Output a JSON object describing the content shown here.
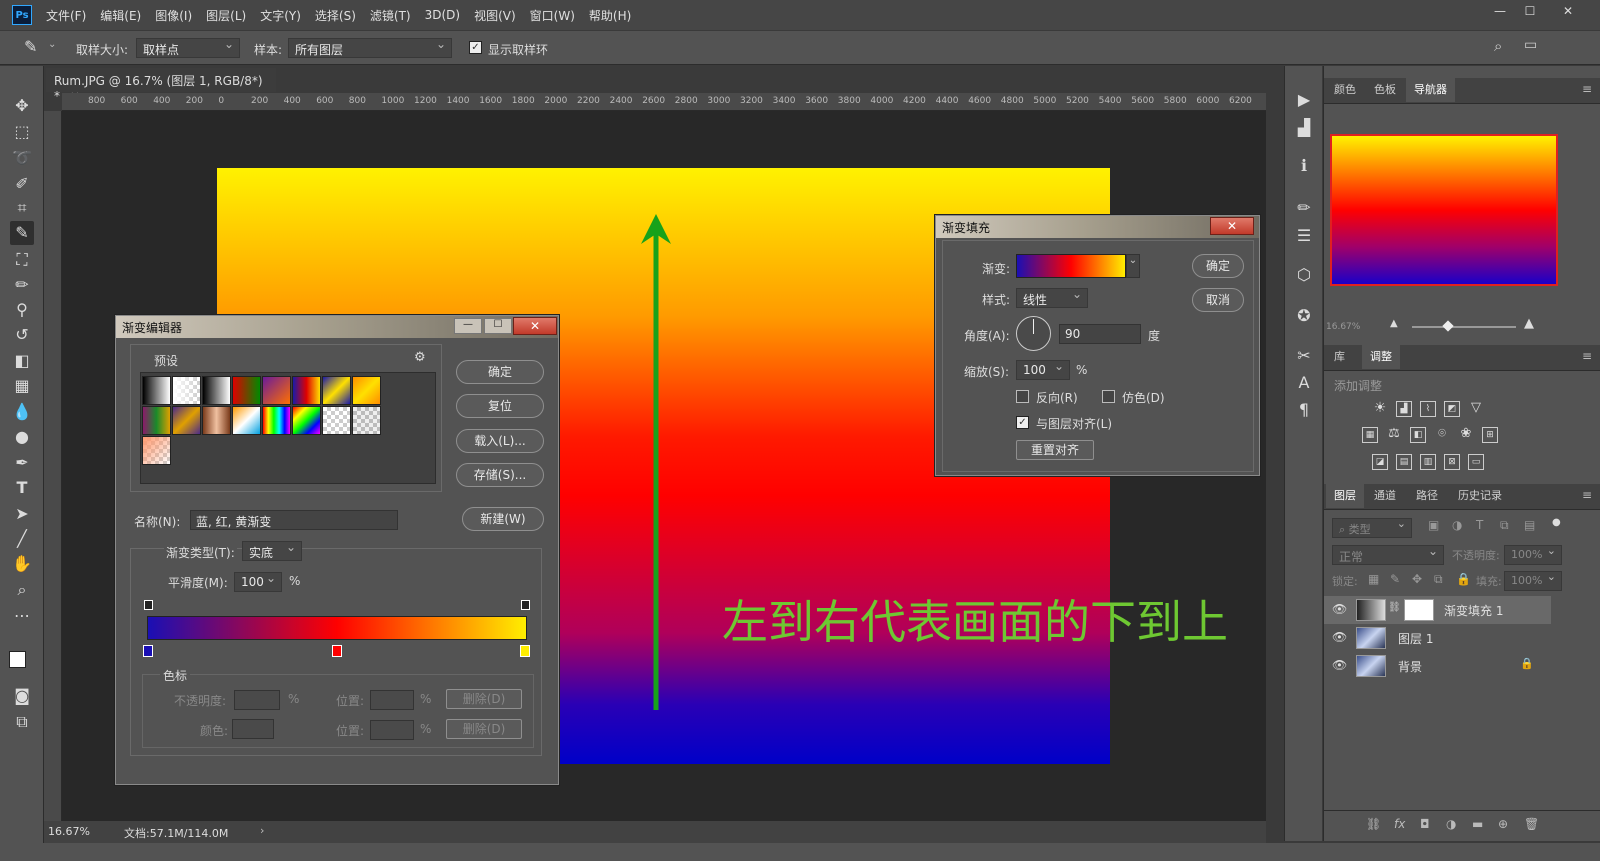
{
  "menu": {
    "logo": "Ps",
    "items": [
      "文件(F)",
      "编辑(E)",
      "图像(I)",
      "图层(L)",
      "文字(Y)",
      "选择(S)",
      "滤镜(T)",
      "3D(D)",
      "视图(V)",
      "窗口(W)",
      "帮助(H)"
    ]
  },
  "options": {
    "sample_size_label": "取样大小:",
    "sample_size_value": "取样点",
    "sample_label": "样本:",
    "sample_value": "所有图层",
    "show_ring_label": "显示取样环"
  },
  "document": {
    "tab_title": "Rum.JPG @ 16.7% (图层 1, RGB/8*) *",
    "ruler_marks": [
      "800",
      "600",
      "400",
      "200",
      "0",
      "200",
      "400",
      "600",
      "800",
      "1000",
      "1200",
      "1400",
      "1600",
      "1800",
      "2000",
      "2200",
      "2400",
      "2600",
      "2800",
      "3000",
      "3200",
      "3400",
      "3600",
      "3800",
      "4000",
      "4200",
      "4400",
      "4600",
      "4800",
      "5000",
      "5200",
      "5400",
      "5600",
      "5800",
      "6000",
      "6200"
    ],
    "zoom": "16.67%",
    "doc_info": "文档:57.1M/114.0M",
    "annotation": "左到右代表画面的下到上"
  },
  "gradient_editor": {
    "title": "渐变编辑器",
    "presets_label": "预设",
    "ok": "确定",
    "reset": "复位",
    "load": "载入(L)...",
    "save": "存储(S)...",
    "name_label": "名称(N):",
    "name_value": "蓝, 红, 黄渐变",
    "new_button": "新建(W)",
    "type_label": "渐变类型(T):",
    "type_value": "实底",
    "smooth_label": "平滑度(M):",
    "smooth_value": "100",
    "smooth_unit": "%",
    "stops_group": "色标",
    "opacity_label": "不透明度:",
    "position_label": "位置:",
    "color_label": "颜色:",
    "percent": "%",
    "delete_label": "删除(D)"
  },
  "gradient_fill": {
    "title": "渐变填充",
    "gradient_label": "渐变:",
    "style_label": "样式:",
    "style_value": "线性",
    "angle_label": "角度(A):",
    "angle_value": "90",
    "angle_unit": "度",
    "scale_label": "缩放(S):",
    "scale_value": "100",
    "scale_unit": "%",
    "reverse_label": "反向(R)",
    "dither_label": "仿色(D)",
    "align_label": "与图层对齐(L)",
    "reset_align": "重置对齐",
    "ok": "确定",
    "cancel": "取消"
  },
  "panels": {
    "top_tabs": [
      "颜色",
      "色板",
      "导航器"
    ],
    "nav_zoom": "16.67%",
    "adj_tabs": [
      "库",
      "调整"
    ],
    "adj_title": "添加调整",
    "layer_tabs": [
      "图层",
      "通道",
      "路径",
      "历史记录"
    ],
    "filter_kind": "类型",
    "blend_mode": "正常",
    "opacity_label": "不透明度:",
    "opacity_value": "100%",
    "lock_label": "锁定:",
    "fill_label": "填充:",
    "fill_value": "100%",
    "layers": [
      {
        "name": "渐变填充 1"
      },
      {
        "name": "图层 1"
      },
      {
        "name": "背景"
      }
    ]
  },
  "colors": {
    "accent_green": "#17a21a",
    "annotation_green": "#6ec832",
    "close_red": "#c23a2a"
  }
}
